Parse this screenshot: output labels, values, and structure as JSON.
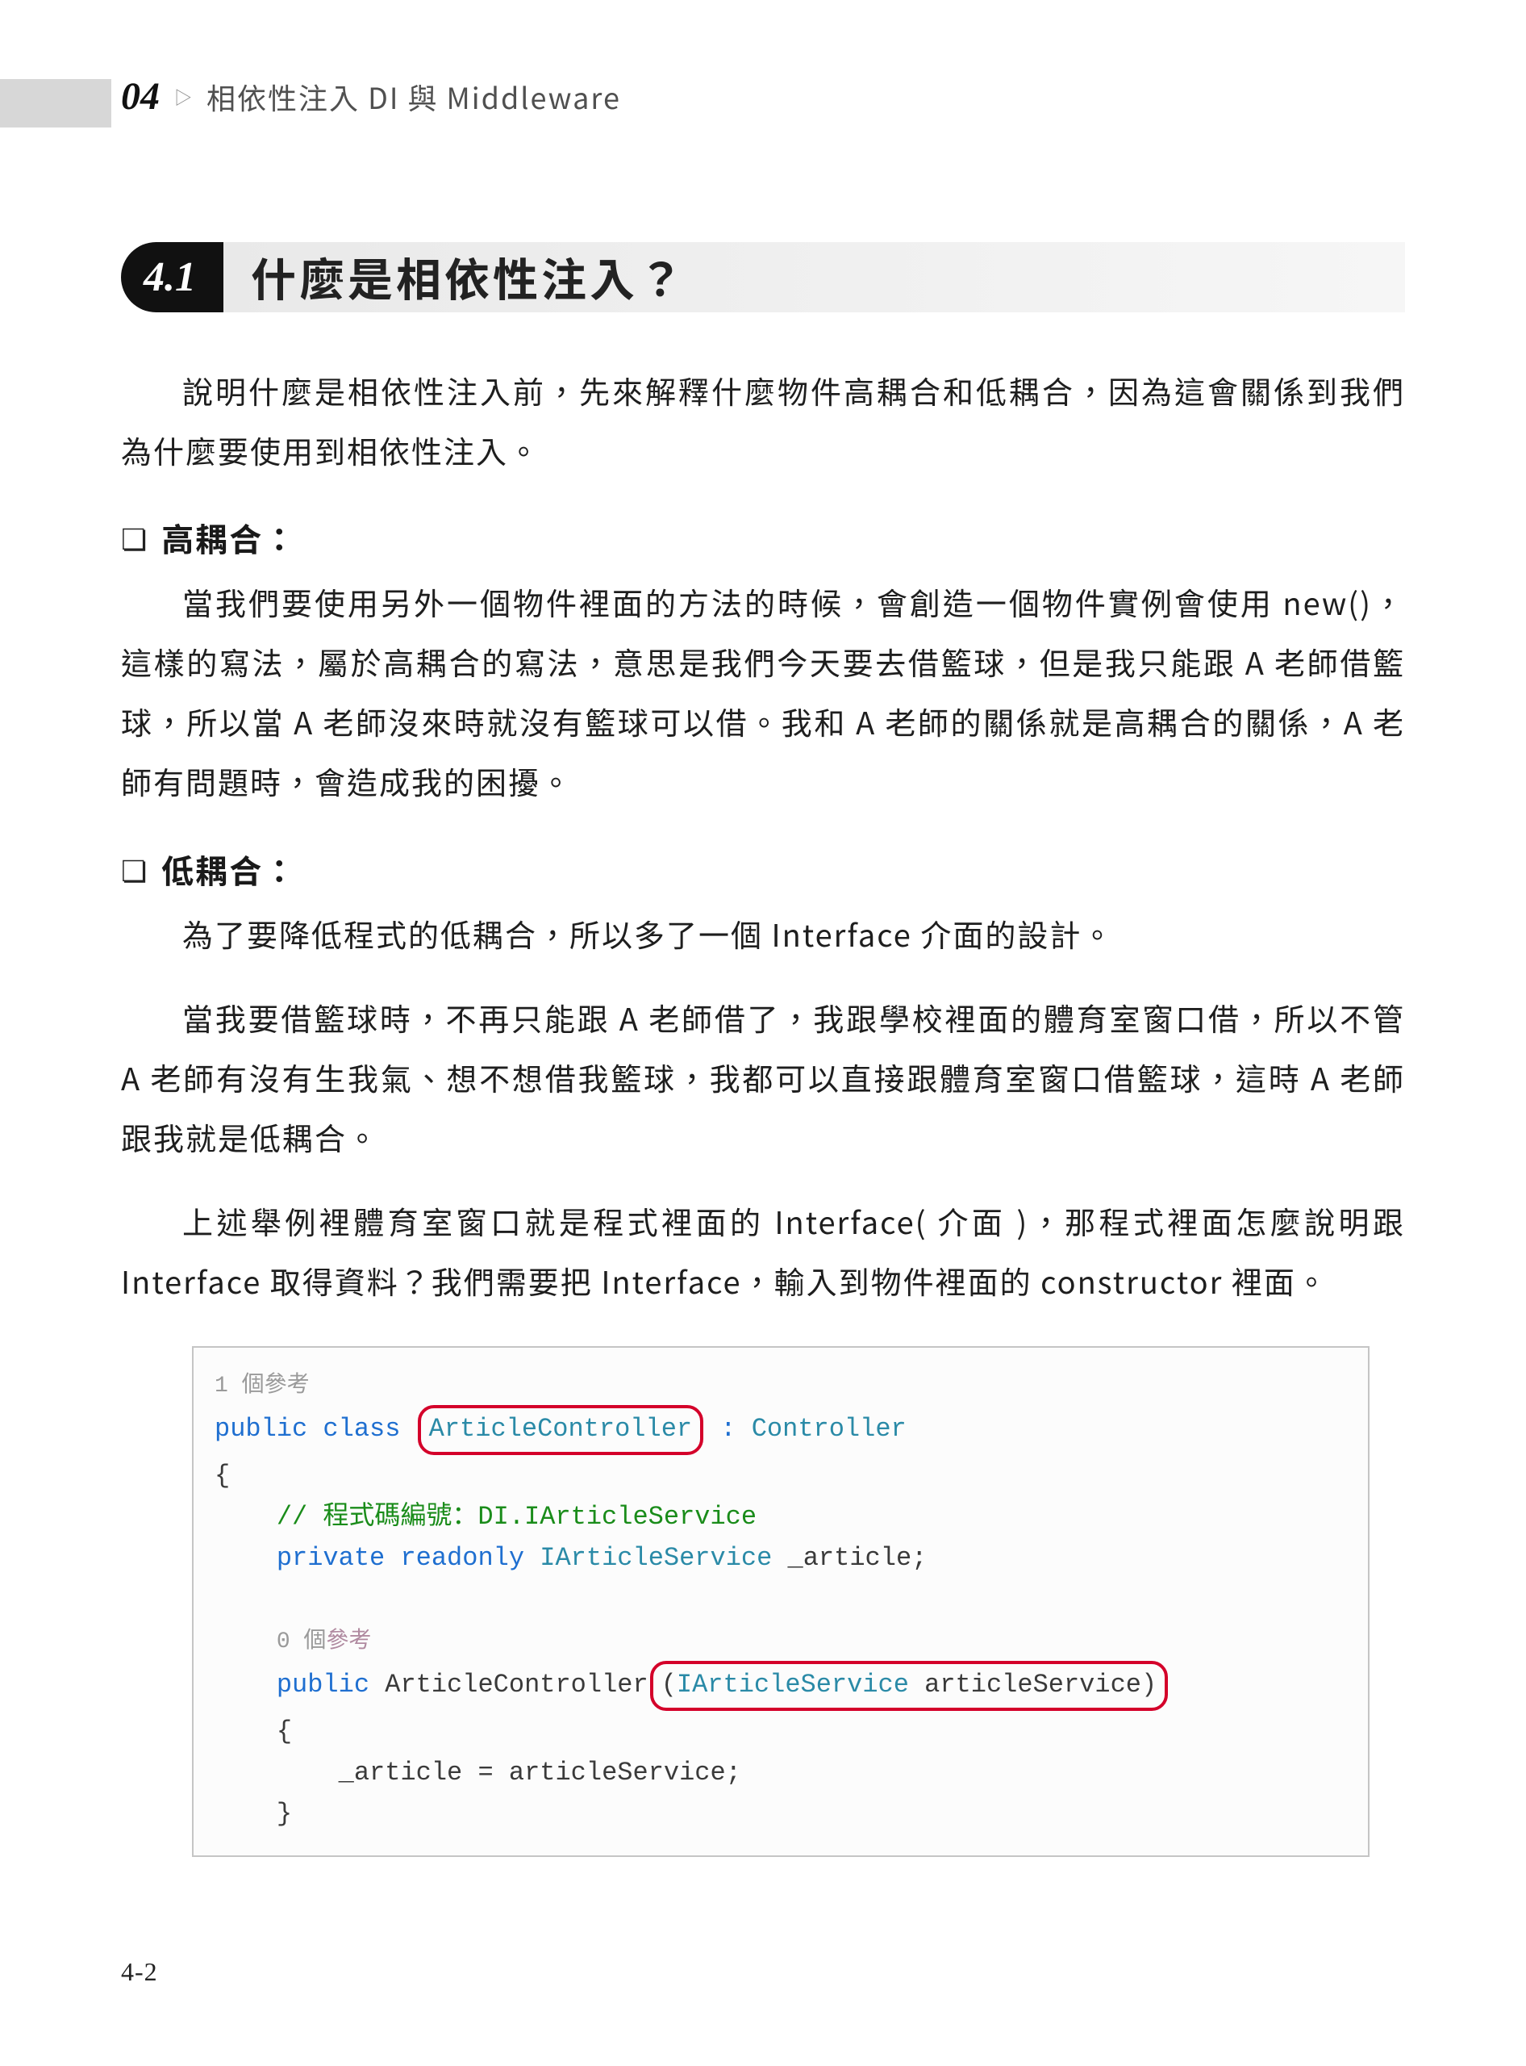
{
  "header": {
    "chapter_num": "04",
    "chapter_title": "相依性注入 DI 與 Middleware"
  },
  "section": {
    "badge": "4.1",
    "title": "什麼是相依性注入？"
  },
  "intro": "說明什麼是相依性注入前，先來解釋什麼物件高耦合和低耦合，因為這會關係到我們為什麼要使用到相依性注入。",
  "high": {
    "title": "高耦合：",
    "body": "當我們要使用另外一個物件裡面的方法的時候，會創造一個物件實例會使用 new()，這樣的寫法，屬於高耦合的寫法，意思是我們今天要去借籃球，但是我只能跟 A 老師借籃球，所以當 A 老師沒來時就沒有籃球可以借。我和 A 老師的關係就是高耦合的關係，A 老師有問題時，會造成我的困擾。"
  },
  "low": {
    "title": "低耦合：",
    "p1": "為了要降低程式的低耦合，所以多了一個 Interface 介面的設計。",
    "p2": "當我要借籃球時，不再只能跟 A 老師借了，我跟學校裡面的體育室窗口借，所以不管 A 老師有沒有生我氣、想不想借我籃球，我都可以直接跟體育室窗口借籃球，這時 A 老師跟我就是低耦合。",
    "p3": "上述舉例裡體育室窗口就是程式裡面的 Interface( 介面 )，那程式裡面怎麼說明跟 Interface 取得資料？我們需要把 Interface，輸入到物件裡面的 constructor 裡面。"
  },
  "code": {
    "ref1": "1 個參考",
    "kw_public": "public",
    "kw_class": "class",
    "cls_name": "ArticleController",
    "colon": ":",
    "base": "Controller",
    "brace_open": "{",
    "comment": "// 程式碼編號：DI.IArticleService",
    "kw_private": "private",
    "kw_readonly": "readonly",
    "svc_type": "IArticleService",
    "field": "_article",
    "semi": ";",
    "ref0": "0 個參考",
    "ctor": "ArticleController",
    "param_open": "(",
    "param_type": "IArticleService",
    "param_name": "articleService",
    "param_close": ")",
    "assign": "_article = articleService;",
    "brace_close": "}"
  },
  "page_num": "4-2"
}
